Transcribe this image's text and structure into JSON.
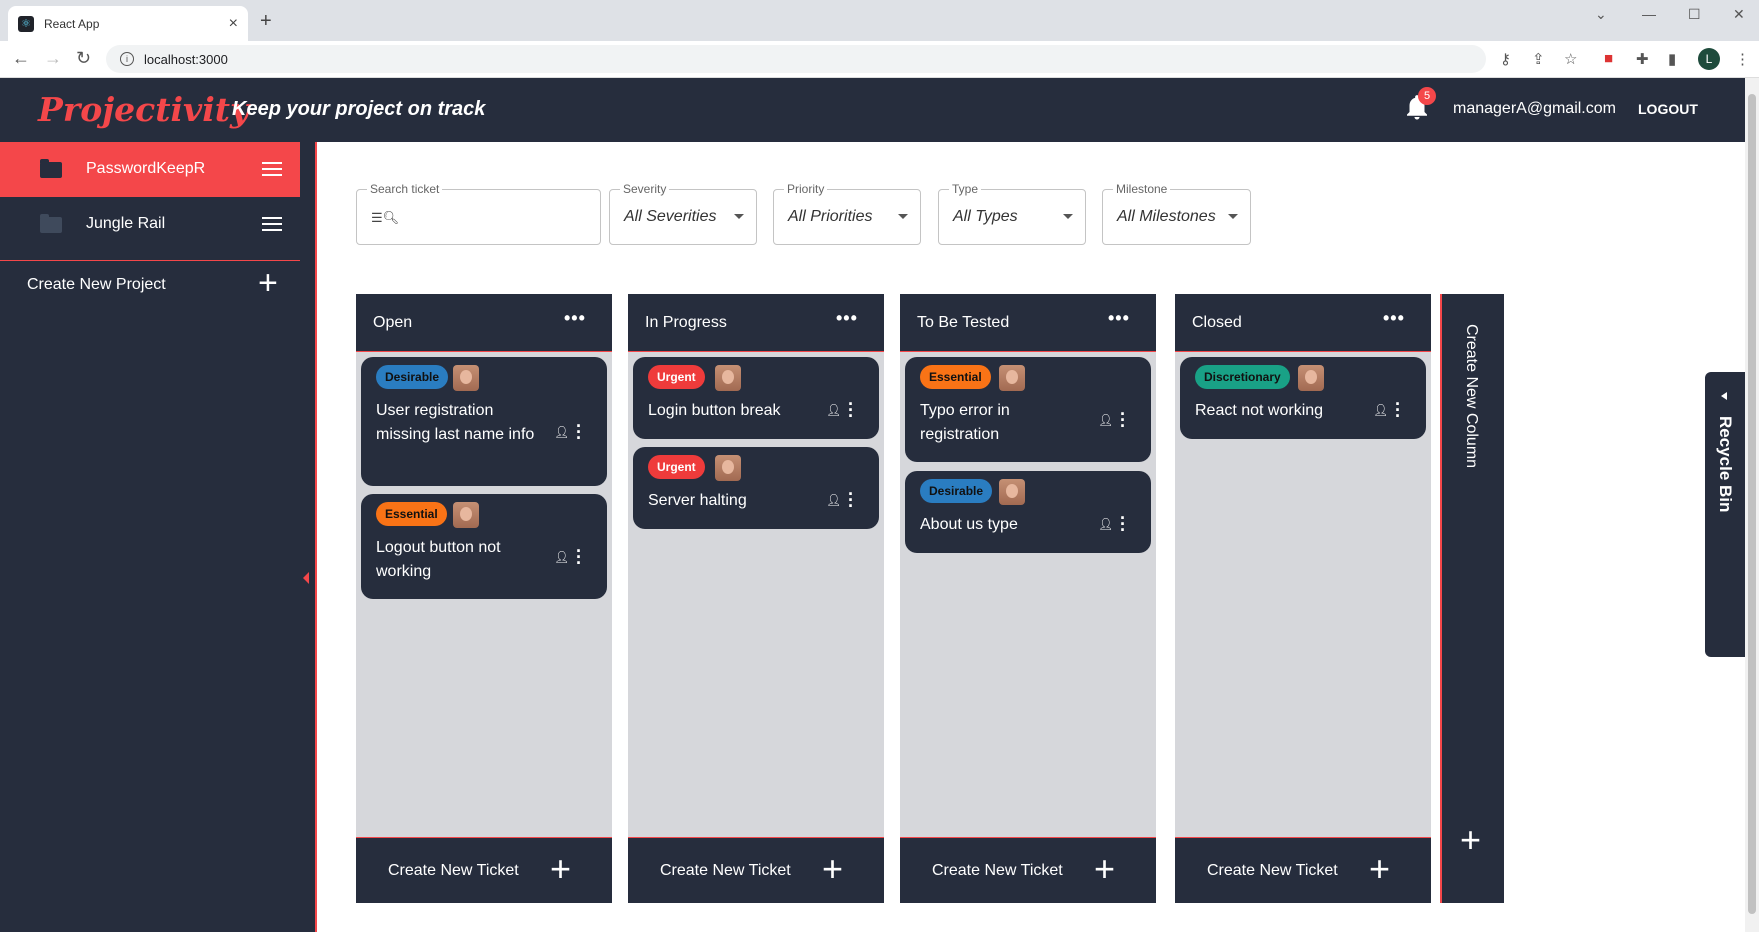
{
  "browser": {
    "tab_title": "React App",
    "url": "localhost:3000",
    "profile_initial": "L"
  },
  "header": {
    "brand": "Projectivity",
    "tagline": "Keep your project on track",
    "notification_count": "5",
    "user_email": "managerA@gmail.com",
    "logout_label": "LOGOUT"
  },
  "sidebar": {
    "projects": [
      {
        "name": "PasswordKeepR",
        "active": true
      },
      {
        "name": "Jungle Rail",
        "active": false
      }
    ],
    "create_project_label": "Create New Project"
  },
  "filters": {
    "search_label": "Search ticket",
    "severity_label": "Severity",
    "severity_value": "All Severities",
    "priority_label": "Priority",
    "priority_value": "All Priorities",
    "type_label": "Type",
    "type_value": "All Types",
    "milestone_label": "Milestone",
    "milestone_value": "All Milestones"
  },
  "columns": [
    {
      "title": "Open",
      "create_ticket_label": "Create New Ticket",
      "tickets": [
        {
          "tag": "Desirable",
          "title": "User registration missing last name info"
        },
        {
          "tag": "Essential",
          "title": "Logout button not working"
        }
      ]
    },
    {
      "title": "In Progress",
      "create_ticket_label": "Create New Ticket",
      "tickets": [
        {
          "tag": "Urgent",
          "title": "Login button break"
        },
        {
          "tag": "Urgent",
          "title": "Server halting"
        }
      ]
    },
    {
      "title": "To Be Tested",
      "create_ticket_label": "Create New Ticket",
      "tickets": [
        {
          "tag": "Essential",
          "title": "Typo error in registration"
        },
        {
          "tag": "Desirable",
          "title": "About us type"
        }
      ]
    },
    {
      "title": "Closed",
      "create_ticket_label": "Create New Ticket",
      "tickets": [
        {
          "tag": "Discretionary",
          "title": "React not working"
        }
      ]
    }
  ],
  "create_column_label": "Create New Column",
  "recycle_bin_label": "Recycle Bin",
  "colors": {
    "accent": "#f4474a",
    "dark": "#262d3d",
    "desirable": "#2a7dc1",
    "essential": "#f97316",
    "urgent": "#ef3b3b",
    "discretionary": "#19a186"
  }
}
